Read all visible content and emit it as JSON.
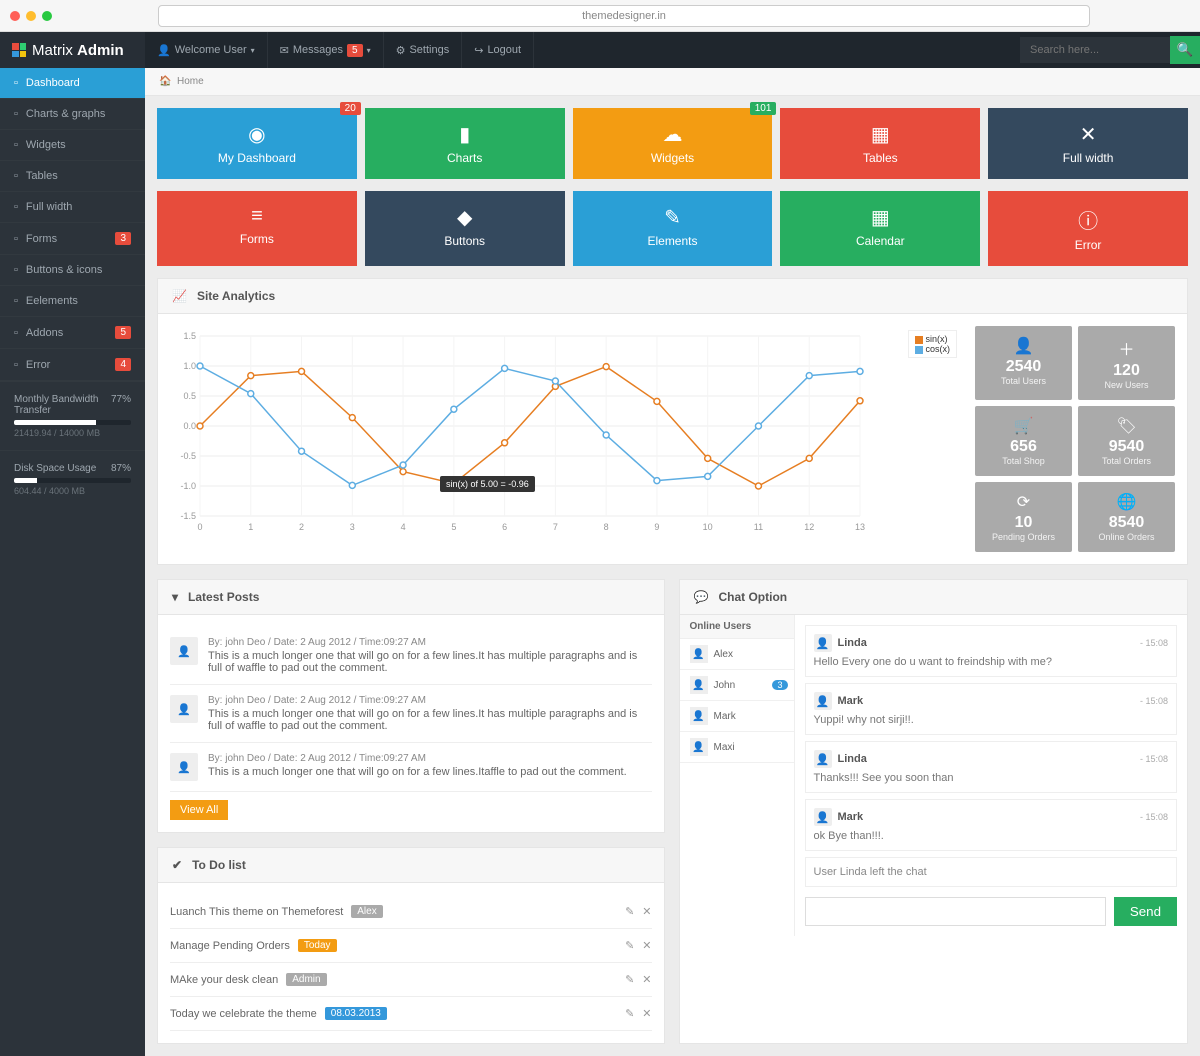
{
  "browser": {
    "url": "themedesigner.in"
  },
  "brand": {
    "name1": "Matrix",
    "name2": "Admin"
  },
  "topnav": {
    "welcome": "Welcome User",
    "messages": "Messages",
    "messages_badge": "5",
    "settings": "Settings",
    "logout": "Logout",
    "search_placeholder": "Search here..."
  },
  "breadcrumb": {
    "home": "Home"
  },
  "sidebar": {
    "items": [
      {
        "label": "Dashboard",
        "active": true
      },
      {
        "label": "Charts & graphs"
      },
      {
        "label": "Widgets"
      },
      {
        "label": "Tables"
      },
      {
        "label": "Full width"
      },
      {
        "label": "Forms",
        "badge": "3"
      },
      {
        "label": "Buttons & icons"
      },
      {
        "label": "Eelements"
      },
      {
        "label": "Addons",
        "badge": "5"
      },
      {
        "label": "Error",
        "badge": "4"
      }
    ],
    "stats": [
      {
        "label": "Monthly Bandwidth Transfer",
        "pct": "77%",
        "sub": "21419.94 / 14000 MB",
        "width": 70
      },
      {
        "label": "Disk Space Usage",
        "pct": "87%",
        "sub": "604.44 / 4000 MB",
        "width": 20
      }
    ]
  },
  "tiles_row1": [
    {
      "label": "My Dashboard",
      "color": "#2a9fd6",
      "icon": "◉",
      "badge": "20"
    },
    {
      "label": "Charts",
      "color": "#27ae60",
      "icon": "▮"
    },
    {
      "label": "Widgets",
      "color": "#f39c12",
      "icon": "☁",
      "badge": "101",
      "badge_color": "#27ae60"
    },
    {
      "label": "Tables",
      "color": "#e74c3c",
      "icon": "▦"
    },
    {
      "label": "Full width",
      "color": "#34495e",
      "icon": "✕"
    }
  ],
  "tiles_row2": [
    {
      "label": "Forms",
      "color": "#e74c3c",
      "icon": "≡"
    },
    {
      "label": "Buttons",
      "color": "#34495e",
      "icon": "◆"
    },
    {
      "label": "Elements",
      "color": "#2a9fd6",
      "icon": "✎"
    },
    {
      "label": "Calendar",
      "color": "#27ae60",
      "icon": "▦"
    },
    {
      "label": "Error",
      "color": "#e74c3c",
      "icon": "ⓘ"
    }
  ],
  "analytics": {
    "title": "Site Analytics",
    "tooltip": "sin(x) of 5.00 = -0.96",
    "stats": [
      {
        "icon": "👤",
        "val": "2540",
        "lab": "Total Users"
      },
      {
        "icon": "＋",
        "val": "120",
        "lab": "New Users"
      },
      {
        "icon": "🛒",
        "val": "656",
        "lab": "Total Shop"
      },
      {
        "icon": "🏷",
        "val": "9540",
        "lab": "Total Orders"
      },
      {
        "icon": "⟳",
        "val": "10",
        "lab": "Pending Orders"
      },
      {
        "icon": "🌐",
        "val": "8540",
        "lab": "Online Orders"
      }
    ]
  },
  "chart_data": {
    "type": "line",
    "x": [
      0,
      1,
      2,
      3,
      4,
      5,
      6,
      7,
      8,
      9,
      10,
      11,
      12,
      13
    ],
    "series": [
      {
        "name": "sin(x)",
        "color": "#e67e22",
        "values": [
          0.0,
          0.84,
          0.91,
          0.14,
          -0.76,
          -0.96,
          -0.28,
          0.66,
          0.99,
          0.41,
          -0.54,
          -1.0,
          -0.54,
          0.42
        ]
      },
      {
        "name": "cos(x)",
        "color": "#5dade2",
        "values": [
          1.0,
          0.54,
          -0.42,
          -0.99,
          -0.65,
          0.28,
          0.96,
          0.75,
          -0.15,
          -0.91,
          -0.84,
          0.0,
          0.84,
          0.91
        ]
      }
    ],
    "ylim": [
      -1.5,
      1.5
    ],
    "yticks": [
      -1.5,
      -1.0,
      -0.5,
      0,
      0.5,
      1.0,
      1.5
    ]
  },
  "latest_posts": {
    "title": "Latest Posts",
    "view_all": "View All",
    "posts": [
      {
        "meta": "By: john Deo / Date: 2 Aug 2012 / Time:09:27 AM",
        "body": "This is a much longer one that will go on for a few lines.It has multiple paragraphs and is full of waffle to pad out the comment."
      },
      {
        "meta": "By: john Deo / Date: 2 Aug 2012 / Time:09:27 AM",
        "body": "This is a much longer one that will go on for a few lines.It has multiple paragraphs and is full of waffle to pad out the comment."
      },
      {
        "meta": "By: john Deo / Date: 2 Aug 2012 / Time:09:27 AM",
        "body": "This is a much longer one that will go on for a few lines.Itaffle to pad out the comment."
      }
    ]
  },
  "todo": {
    "title": "To Do list",
    "items": [
      {
        "text": "Luanch This theme on Themeforest",
        "tag": "Alex",
        "tag_color": "#aaa"
      },
      {
        "text": "Manage Pending Orders",
        "tag": "Today",
        "tag_color": "#f39c12"
      },
      {
        "text": "MAke your desk clean",
        "tag": "Admin",
        "tag_color": "#aaa"
      },
      {
        "text": "Today we celebrate the theme",
        "tag": "08.03.2013",
        "tag_color": "#3498db"
      }
    ]
  },
  "chat": {
    "title": "Chat Option",
    "online_title": "Online Users",
    "users": [
      {
        "name": "Alex"
      },
      {
        "name": "John",
        "count": "3"
      },
      {
        "name": "Mark"
      },
      {
        "name": "Maxi"
      }
    ],
    "messages": [
      {
        "name": "Linda",
        "time": "- 15:08",
        "text": "Hello Every one do u want to freindship with me?"
      },
      {
        "name": "Mark",
        "time": "- 15:08",
        "text": "Yuppi! why not sirji!!."
      },
      {
        "name": "Linda",
        "time": "- 15:08",
        "text": "Thanks!!! See you soon than"
      },
      {
        "name": "Mark",
        "time": "- 15:08",
        "text": "ok Bye than!!!."
      }
    ],
    "status": "User Linda left the chat",
    "send": "Send"
  }
}
